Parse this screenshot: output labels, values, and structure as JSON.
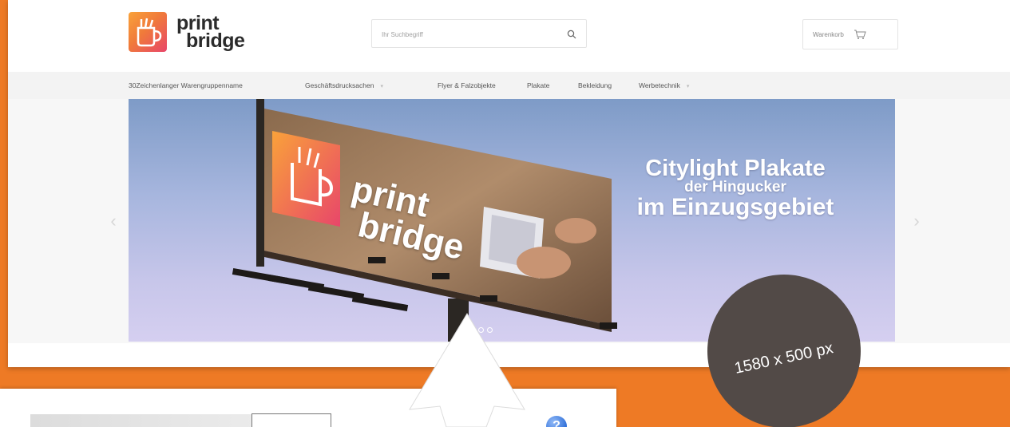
{
  "logo": {
    "line1": "print",
    "line2": "bridge"
  },
  "search": {
    "placeholder": "Ihr Suchbegriff"
  },
  "cart": {
    "label": "Warenkorb"
  },
  "nav": {
    "items": [
      {
        "label": "30Zeichenlanger Warengruppenname",
        "has_dropdown": false
      },
      {
        "label": "Geschäftsdrucksachen",
        "has_dropdown": true
      },
      {
        "label": "Flyer & Falzobjekte",
        "has_dropdown": false
      },
      {
        "label": "Plakate",
        "has_dropdown": false
      },
      {
        "label": "Bekleidung",
        "has_dropdown": false
      },
      {
        "label": "Werbetechnik",
        "has_dropdown": true
      }
    ]
  },
  "hero": {
    "headline_1": "Citylight Plakate",
    "headline_2": "der Hingucker",
    "headline_3": "im Einzugsgebiet",
    "billboard_text_1": "print",
    "billboard_text_2": "bridge",
    "slides": 4,
    "active_slide": 1
  },
  "badge": {
    "text": "1580 x 500 px"
  },
  "colors": {
    "background_orange": "#ee7a25",
    "badge_gray": "#524a47",
    "logo_gradient_start": "#f9a23a",
    "logo_gradient_end": "#e8466a"
  }
}
